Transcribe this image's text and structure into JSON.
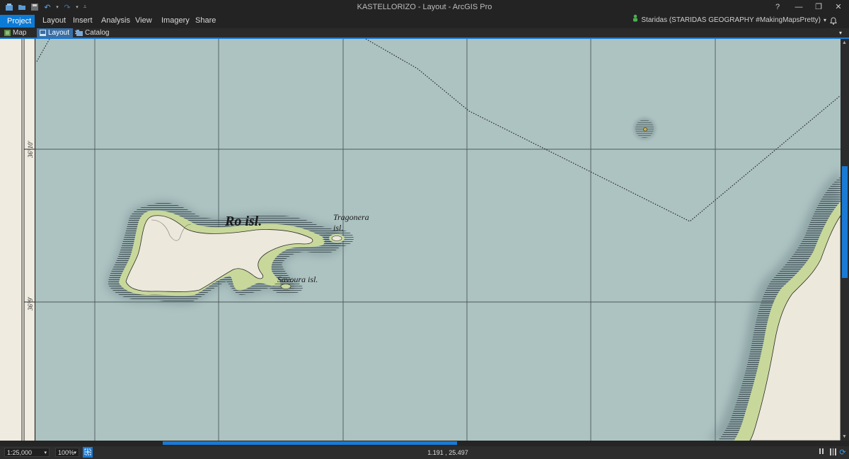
{
  "window": {
    "title": "KASTELLORIZO - Layout - ArcGIS Pro",
    "help_label": "?",
    "minimize_label": "—",
    "restore_label": "❐",
    "close_label": "✕"
  },
  "quick_access": {
    "new_icon": "new-project-icon",
    "open_icon": "open-project-icon",
    "save_icon": "save-project-icon",
    "undo_icon": "undo-icon",
    "redo_icon": "redo-icon",
    "customize_icon": "customize-quick-access-icon"
  },
  "ribbon": {
    "tabs": [
      "Project",
      "Layout",
      "Insert",
      "Analysis",
      "View",
      "Imagery",
      "Share"
    ]
  },
  "user": {
    "name": "Staridas (STARIDAS GEOGRAPHY #MakingMapsPretty)",
    "chevron": "▾",
    "bell_icon": "notifications-icon"
  },
  "view_tabs": [
    {
      "label": "Map",
      "icon": "map-icon",
      "active": false
    },
    {
      "label": "Layout",
      "icon": "layout-icon",
      "active": true,
      "close": "✕"
    },
    {
      "label": "Catalog",
      "icon": "catalog-icon",
      "active": false
    }
  ],
  "view_menu_chevron": "▾",
  "map": {
    "labels": {
      "ro": "Ro isl.",
      "tragonera_1": "Tragonera",
      "tragonera_2": "isl.",
      "savoura": "Savoura isl."
    },
    "latitude_ticks": [
      "36°10'",
      "36°9'"
    ],
    "colors": {
      "sea": "#a9c0c0",
      "land": "#ece8dc",
      "coast_fill": "#c8d89a",
      "hachure": "#2c3a40",
      "frame": "#efebe0",
      "grid": "#3a4646"
    }
  },
  "status": {
    "scale": "1:25,000",
    "zoom": "100%",
    "coordinates": "1.191 , 25.497",
    "pause_icon": "pause-drawing-icon",
    "toc_icon": "table-of-contents-icon",
    "refresh_icon": "refresh-icon"
  }
}
